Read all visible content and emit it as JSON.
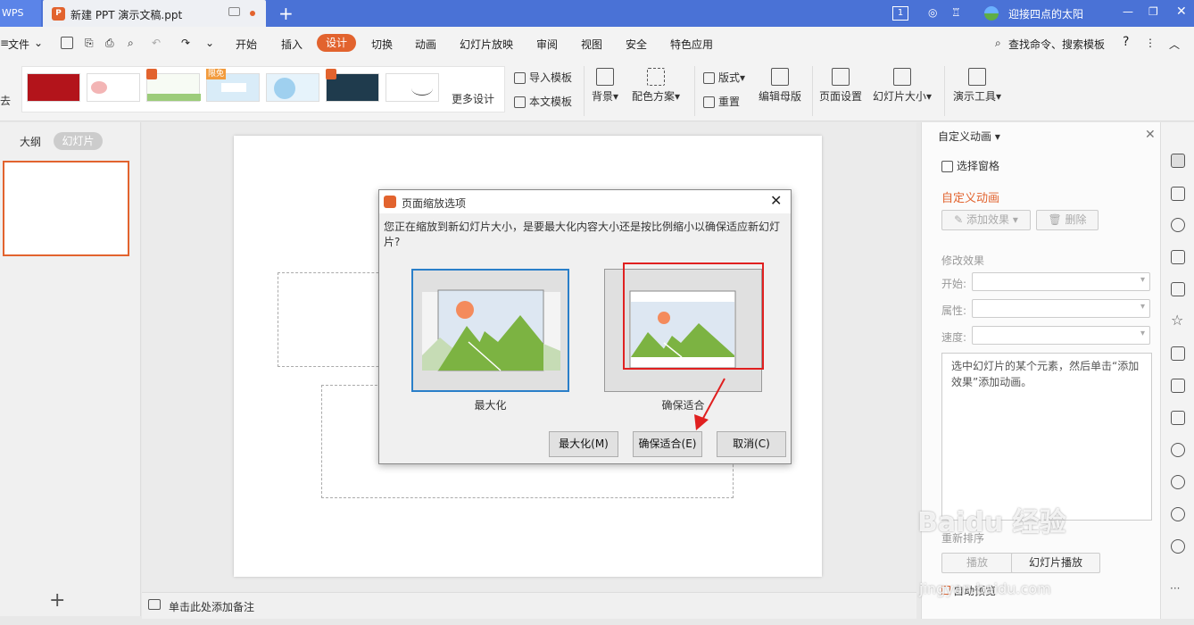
{
  "titlebar": {
    "app_label": "WPS",
    "doc_title": "新建 PPT 演示文稿.ppt",
    "badge": "1",
    "user_name": "迎接四点的太阳"
  },
  "menu": {
    "file": "文件",
    "items": [
      "开始",
      "插入",
      "设计",
      "切换",
      "动画",
      "幻灯片放映",
      "审阅",
      "视图",
      "安全",
      "特色应用"
    ],
    "active": "设计",
    "search": "查找命令、搜索模板",
    "help": "?"
  },
  "ribbon": {
    "limited_badge": "限免",
    "more_designs": "更多设计",
    "import_template": "导入模板",
    "text_template": "本文模板",
    "background": "背景",
    "color_scheme": "配色方案",
    "layout": "版式",
    "reset": "重置",
    "edit_master": "编辑母版",
    "page_setup": "页面设置",
    "slide_size": "幻灯片大小",
    "presentation_tools": "演示工具"
  },
  "left_panel": {
    "outline": "大纲",
    "slides": "幻灯片"
  },
  "notes": {
    "placeholder": "单击此处添加备注"
  },
  "right_panel": {
    "title": "自定义动画",
    "selection_pane": "选择窗格",
    "section": "自定义动画",
    "add_effect": "添加效果",
    "delete": "删除",
    "modify": "修改效果",
    "start": "开始:",
    "property": "属性:",
    "speed": "速度:",
    "hint": "选中幻灯片的某个元素，然后单击“添加效果”添加动画。",
    "reorder": "重新排序",
    "play": "播放",
    "slideshow": "幻灯片播放",
    "autopreview": "自动预览"
  },
  "dialog": {
    "title": "页面缩放选项",
    "message": "您正在缩放到新幻灯片大小，是要最大化内容大小还是按比例缩小以确保适应新幻灯片?",
    "option_max": "最大化",
    "option_fit": "确保适合",
    "btn_max": "最大化(M)",
    "btn_fit": "确保适合(E)",
    "btn_cancel": "取消(C)"
  },
  "watermark": {
    "brand": "Baidu 经验",
    "url": "jingyan.baidu.com"
  },
  "colors": {
    "accent": "#e2632e",
    "titlebar": "#4a72d6",
    "highlight": "#e02020",
    "selected": "#2a7fc9"
  }
}
